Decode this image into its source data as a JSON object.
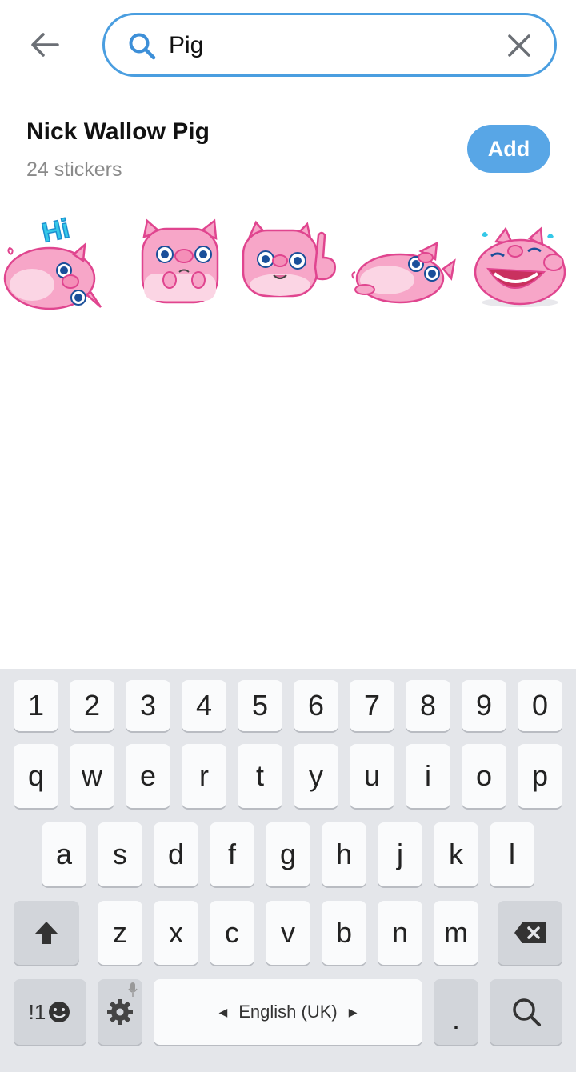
{
  "header": {
    "search": {
      "value": "Pig",
      "placeholder": "Search"
    }
  },
  "pack": {
    "title": "Nick Wallow Pig",
    "count_label": "24 stickers",
    "add_label": "Add",
    "stickers": [
      {
        "name": "pig-hi-sticker",
        "text": "Hi"
      },
      {
        "name": "pig-scared-sticker"
      },
      {
        "name": "pig-pointing-sticker"
      },
      {
        "name": "pig-lying-sticker"
      },
      {
        "name": "pig-laughing-sticker"
      }
    ]
  },
  "keyboard": {
    "row_numbers": [
      "1",
      "2",
      "3",
      "4",
      "5",
      "6",
      "7",
      "8",
      "9",
      "0"
    ],
    "row1": [
      "q",
      "w",
      "e",
      "r",
      "t",
      "y",
      "u",
      "i",
      "o",
      "p"
    ],
    "row2": [
      "a",
      "s",
      "d",
      "f",
      "g",
      "h",
      "j",
      "k",
      "l"
    ],
    "row3": [
      "z",
      "x",
      "c",
      "v",
      "b",
      "n",
      "m"
    ],
    "symbols_label": "!1",
    "space_label": "English (UK)",
    "period_label": "."
  },
  "colors": {
    "accent": "#4a9ee0",
    "add_button": "#58a6e6",
    "sticker_pink": "#f7a6c8",
    "sticker_outline": "#e0458f",
    "keyboard_bg": "#e4e6ea"
  }
}
